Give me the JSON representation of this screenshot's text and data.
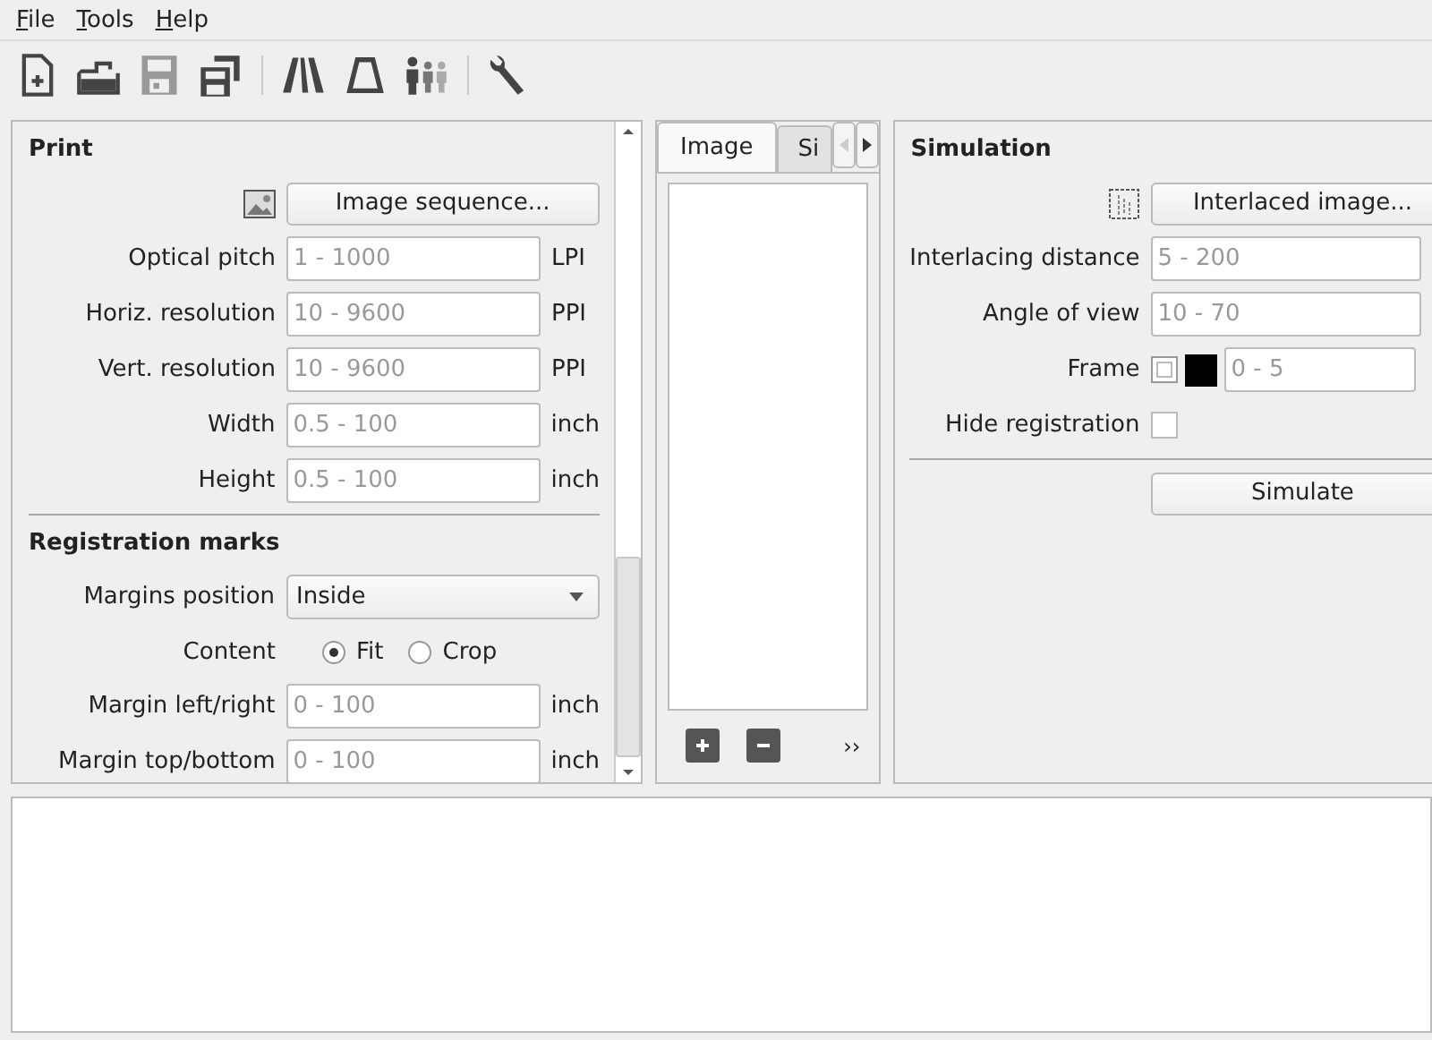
{
  "menu": [
    {
      "label": "File"
    },
    {
      "label": "Tools"
    },
    {
      "label": "Help"
    }
  ],
  "toolbar": [
    {
      "kind": "new",
      "disabled": false
    },
    {
      "kind": "open",
      "disabled": false
    },
    {
      "kind": "save",
      "disabled": true
    },
    {
      "kind": "save_as",
      "disabled": false
    },
    {
      "kind": "separator"
    },
    {
      "kind": "lens",
      "disabled": false
    },
    {
      "kind": "trapezoid",
      "disabled": false
    },
    {
      "kind": "people",
      "disabled": false
    },
    {
      "kind": "separator"
    },
    {
      "kind": "wrench",
      "disabled": false
    }
  ],
  "print": {
    "title": "Print",
    "image_button": "Image sequence...",
    "fields": [
      {
        "label": "Optical pitch",
        "placeholder": "1 - 1000",
        "unit": "LPI"
      },
      {
        "label": "Horiz. resolution",
        "placeholder": "10 - 9600",
        "unit": "PPI"
      },
      {
        "label": "Vert. resolution",
        "placeholder": "10 - 9600",
        "unit": "PPI"
      },
      {
        "label": "Width",
        "placeholder": "0.5 - 100",
        "unit": "inch"
      },
      {
        "label": "Height",
        "placeholder": "0.5 - 100",
        "unit": "inch"
      }
    ]
  },
  "registration": {
    "title": "Registration marks",
    "margins_position": {
      "label": "Margins position",
      "value": "Inside"
    },
    "content": {
      "label": "Content",
      "options": [
        {
          "label": "Fit",
          "selected": true
        },
        {
          "label": "Crop",
          "selected": false
        }
      ]
    },
    "fields": [
      {
        "label": "Margin left/right",
        "placeholder": "0 - 100",
        "unit": "inch"
      },
      {
        "label": "Margin top/bottom",
        "placeholder": "0 - 100",
        "unit": "inch"
      }
    ]
  },
  "tabs": [
    {
      "label": "Image",
      "selected": true
    },
    {
      "label": "Si",
      "selected": false
    }
  ],
  "list_footer": {
    "more": "››"
  },
  "simulation": {
    "title": "Simulation",
    "image_button": "Interlaced  image...",
    "fields": [
      {
        "label": "Interlacing distance",
        "placeholder": "5 - 200"
      },
      {
        "label": "Angle of view",
        "placeholder": "10 - 70"
      }
    ],
    "frame": {
      "label": "Frame",
      "checked": false,
      "color": "#000000",
      "placeholder": "0 - 5"
    },
    "hide_registration": {
      "label": "Hide registration",
      "checked": false
    },
    "button": "Simulate"
  }
}
